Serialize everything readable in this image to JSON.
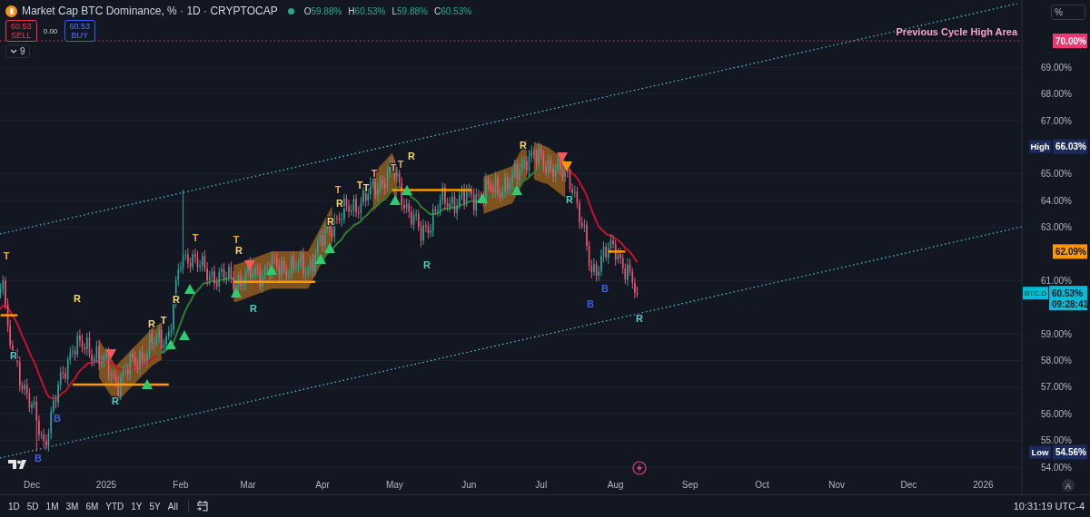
{
  "legend": {
    "title": "Market Cap BTC Dominance, % · 1D · CRYPTOCAP",
    "ohlc": [
      {
        "key": "O",
        "value": "59.88%"
      },
      {
        "key": "H",
        "value": "60.53%"
      },
      {
        "key": "L",
        "value": "59.88%"
      },
      {
        "key": "C",
        "value": "60.53%"
      }
    ],
    "sell": {
      "price": "60.53",
      "label": "SELL"
    },
    "spread": "0.00",
    "buy": {
      "price": "60.53",
      "label": "BUY"
    },
    "indicators": "9"
  },
  "chart": {
    "scale_mode": "%",
    "annotation": "Previous Cycle High Area",
    "price_ticks": [
      "69.00%",
      "68.00%",
      "67.00%",
      "65.00%",
      "64.00%",
      "63.00%",
      "61.00%",
      "59.00%",
      "58.00%",
      "57.00%",
      "56.00%",
      "55.00%",
      "54.00%"
    ],
    "price_labels": [
      {
        "kind": "level",
        "text": "70.00%"
      },
      {
        "kind": "high",
        "tag": "High",
        "text": "66.03%"
      },
      {
        "kind": "line",
        "text": "62.09%"
      },
      {
        "kind": "last",
        "tag": "BTC.D",
        "text": "60.53%",
        "countdown": "09:28:41"
      },
      {
        "kind": "low",
        "tag": "Low",
        "text": "54.56%"
      }
    ],
    "time_ticks": [
      "Dec",
      "2025",
      "Feb",
      "Mar",
      "Apr",
      "May",
      "Jun",
      "Jul",
      "Aug",
      "Sep",
      "Oct",
      "Nov",
      "Dec",
      "2026"
    ],
    "signals": [
      {
        "kind": "top",
        "label": "T"
      },
      {
        "kind": "below",
        "label": "R"
      },
      {
        "kind": "above",
        "label": "R"
      },
      {
        "kind": "bottom",
        "label": "B"
      },
      {
        "kind": "bottom",
        "label": "B"
      },
      {
        "kind": "below",
        "label": "R"
      },
      {
        "kind": "above",
        "label": "R"
      },
      {
        "kind": "above",
        "label": "T"
      },
      {
        "kind": "above",
        "label": "R"
      },
      {
        "kind": "top",
        "label": "T"
      },
      {
        "kind": "top",
        "label": "T"
      },
      {
        "kind": "above",
        "label": "R"
      },
      {
        "kind": "below",
        "label": "R"
      },
      {
        "kind": "above",
        "label": "R"
      },
      {
        "kind": "above",
        "label": "R"
      },
      {
        "kind": "top",
        "label": "T"
      },
      {
        "kind": "above",
        "label": "T"
      },
      {
        "kind": "above",
        "label": "T"
      },
      {
        "kind": "top",
        "label": "T"
      },
      {
        "kind": "top",
        "label": "T"
      },
      {
        "kind": "top",
        "label": "T"
      },
      {
        "kind": "above",
        "label": "R"
      },
      {
        "kind": "below",
        "label": "R"
      },
      {
        "kind": "above",
        "label": "R"
      },
      {
        "kind": "below",
        "label": "R"
      },
      {
        "kind": "bottom",
        "label": "B"
      },
      {
        "kind": "bottom",
        "label": "B"
      },
      {
        "kind": "below",
        "label": "R"
      }
    ],
    "auto_scale": "A"
  },
  "toolbar": {
    "ranges": [
      "1D",
      "5D",
      "1M",
      "3M",
      "6M",
      "YTD",
      "1Y",
      "5Y",
      "All"
    ],
    "clock": "10:31:19 UTC-4"
  }
}
